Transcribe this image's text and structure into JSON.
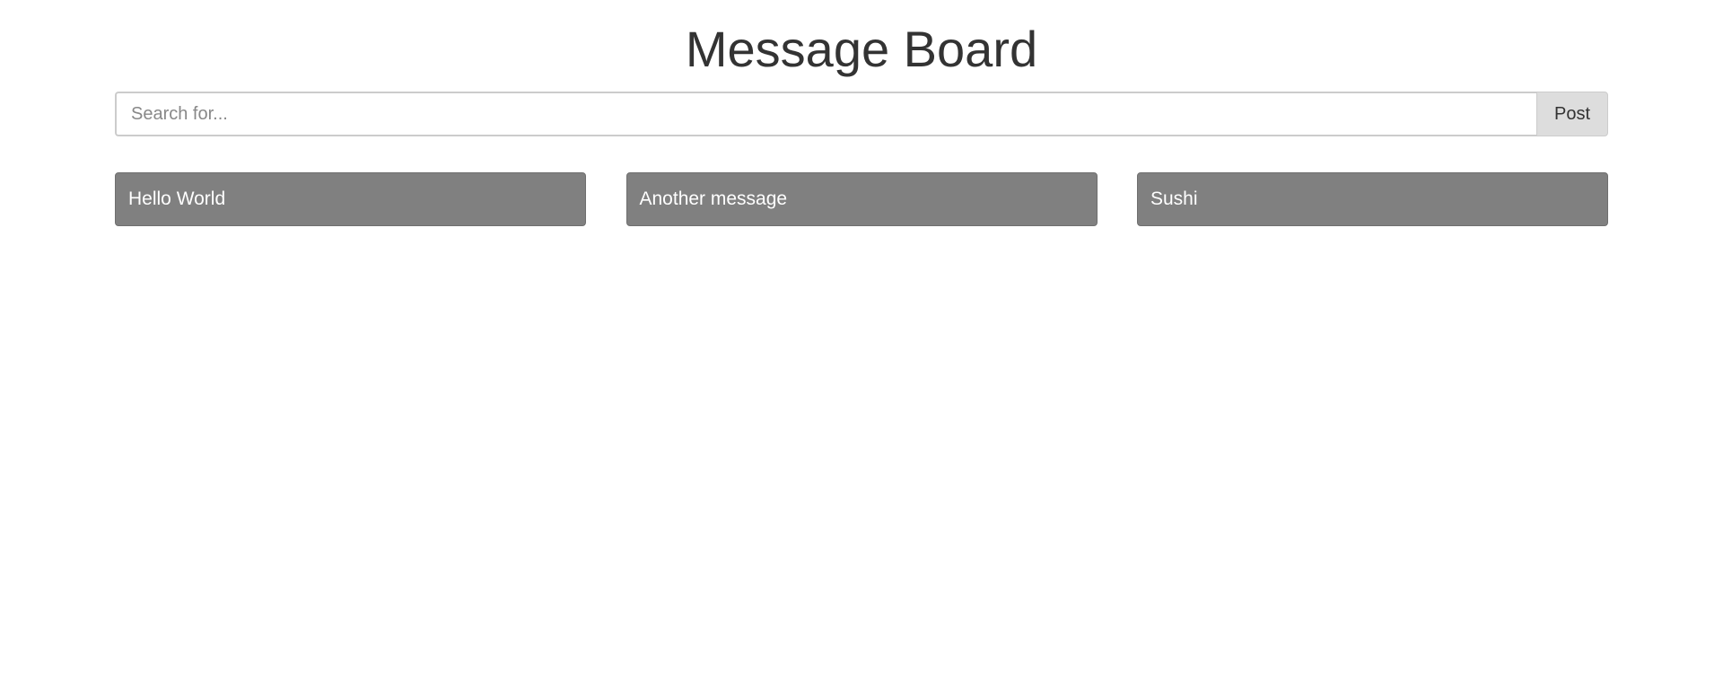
{
  "header": {
    "title": "Message Board"
  },
  "search": {
    "placeholder": "Search for...",
    "value": "",
    "button_label": "Post"
  },
  "messages": [
    {
      "text": "Hello World"
    },
    {
      "text": "Another message"
    },
    {
      "text": "Sushi"
    }
  ]
}
